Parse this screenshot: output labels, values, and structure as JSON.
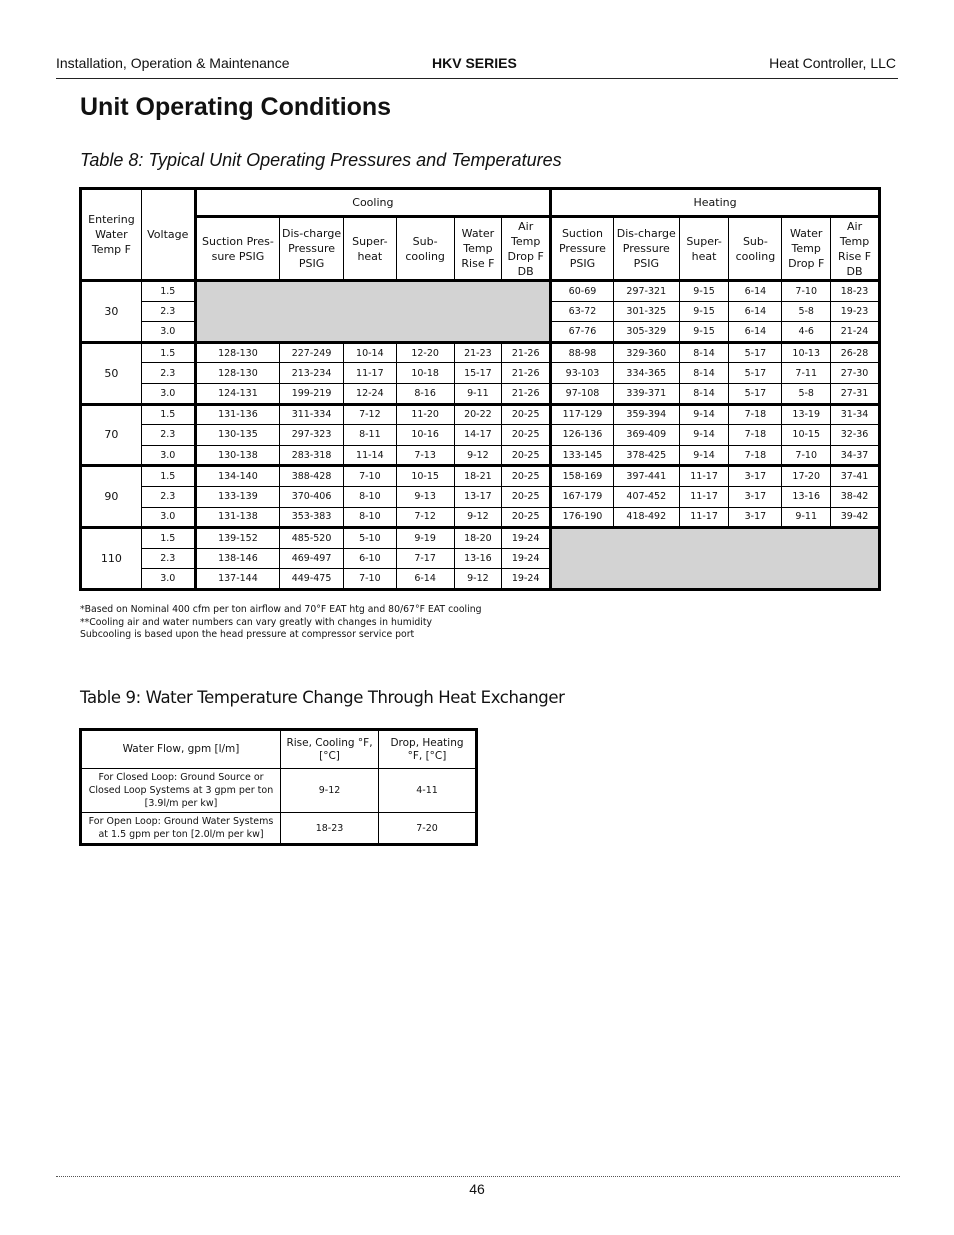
{
  "header": {
    "left": "Installation, Operation & Maintenance",
    "center": "HKV SERIES",
    "right": "Heat Controller, LLC"
  },
  "page_title": "Unit Operating Conditions",
  "table8": {
    "caption": "Table 8: Typical Unit Operating Pressures and Temperatures",
    "col_ewt": "Entering Water Temp F",
    "col_voltage": "Voltage",
    "group_cooling": "Cooling",
    "group_heating": "Heating",
    "cooling_cols": [
      "Suction Pres-sure PSIG",
      "Dis-charge Pressure PSIG",
      "Super-heat",
      "Sub-cooling",
      "Water Temp Rise F",
      "Air Temp Drop F DB"
    ],
    "heating_cols": [
      "Suction Pressure PSIG",
      "Dis-charge Pressure PSIG",
      "Super-heat",
      "Sub-cooling",
      "Water Temp Drop F",
      "Air Temp Rise F DB"
    ],
    "sections": [
      {
        "ewt": "30",
        "rows": [
          {
            "v": "1.5",
            "cooling": null,
            "heating": [
              "60-69",
              "297-321",
              "9-15",
              "6-14",
              "7-10",
              "18-23"
            ]
          },
          {
            "v": "2.3",
            "cooling": null,
            "heating": [
              "63-72",
              "301-325",
              "9-15",
              "6-14",
              "5-8",
              "19-23"
            ]
          },
          {
            "v": "3.0",
            "cooling": null,
            "heating": [
              "67-76",
              "305-329",
              "9-15",
              "6-14",
              "4-6",
              "21-24"
            ]
          }
        ]
      },
      {
        "ewt": "50",
        "rows": [
          {
            "v": "1.5",
            "cooling": [
              "128-130",
              "227-249",
              "10-14",
              "12-20",
              "21-23",
              "21-26"
            ],
            "heating": [
              "88-98",
              "329-360",
              "8-14",
              "5-17",
              "10-13",
              "26-28"
            ]
          },
          {
            "v": "2.3",
            "cooling": [
              "128-130",
              "213-234",
              "11-17",
              "10-18",
              "15-17",
              "21-26"
            ],
            "heating": [
              "93-103",
              "334-365",
              "8-14",
              "5-17",
              "7-11",
              "27-30"
            ]
          },
          {
            "v": "3.0",
            "cooling": [
              "124-131",
              "199-219",
              "12-24",
              "8-16",
              "9-11",
              "21-26"
            ],
            "heating": [
              "97-108",
              "339-371",
              "8-14",
              "5-17",
              "5-8",
              "27-31"
            ]
          }
        ]
      },
      {
        "ewt": "70",
        "rows": [
          {
            "v": "1.5",
            "cooling": [
              "131-136",
              "311-334",
              "7-12",
              "11-20",
              "20-22",
              "20-25"
            ],
            "heating": [
              "117-129",
              "359-394",
              "9-14",
              "7-18",
              "13-19",
              "31-34"
            ]
          },
          {
            "v": "2.3",
            "cooling": [
              "130-135",
              "297-323",
              "8-11",
              "10-16",
              "14-17",
              "20-25"
            ],
            "heating": [
              "126-136",
              "369-409",
              "9-14",
              "7-18",
              "10-15",
              "32-36"
            ]
          },
          {
            "v": "3.0",
            "cooling": [
              "130-138",
              "283-318",
              "11-14",
              "7-13",
              "9-12",
              "20-25"
            ],
            "heating": [
              "133-145",
              "378-425",
              "9-14",
              "7-18",
              "7-10",
              "34-37"
            ]
          }
        ]
      },
      {
        "ewt": "90",
        "rows": [
          {
            "v": "1.5",
            "cooling": [
              "134-140",
              "388-428",
              "7-10",
              "10-15",
              "18-21",
              "20-25"
            ],
            "heating": [
              "158-169",
              "397-441",
              "11-17",
              "3-17",
              "17-20",
              "37-41"
            ]
          },
          {
            "v": "2.3",
            "cooling": [
              "133-139",
              "370-406",
              "8-10",
              "9-13",
              "13-17",
              "20-25"
            ],
            "heating": [
              "167-179",
              "407-452",
              "11-17",
              "3-17",
              "13-16",
              "38-42"
            ]
          },
          {
            "v": "3.0",
            "cooling": [
              "131-138",
              "353-383",
              "8-10",
              "7-12",
              "9-12",
              "20-25"
            ],
            "heating": [
              "176-190",
              "418-492",
              "11-17",
              "3-17",
              "9-11",
              "39-42"
            ]
          }
        ]
      },
      {
        "ewt": "110",
        "rows": [
          {
            "v": "1.5",
            "cooling": [
              "139-152",
              "485-520",
              "5-10",
              "9-19",
              "18-20",
              "19-24"
            ],
            "heating": null
          },
          {
            "v": "2.3",
            "cooling": [
              "138-146",
              "469-497",
              "6-10",
              "7-17",
              "13-16",
              "19-24"
            ],
            "heating": null
          },
          {
            "v": "3.0",
            "cooling": [
              "137-144",
              "449-475",
              "7-10",
              "6-14",
              "9-12",
              "19-24"
            ],
            "heating": null
          }
        ]
      }
    ],
    "notes": [
      "*Based on Nominal 400 cfm per ton airflow and 70°F EAT htg and 80/67°F EAT cooling",
      "**Cooling air and water numbers can vary greatly with changes in humidity",
      "Subcooling is based upon the head pressure at compressor service port"
    ]
  },
  "table9": {
    "caption": "Table 9: Water Temperature Change Through Heat Exchanger",
    "headers": [
      "Water Flow, gpm [l/m]",
      "Rise, Cooling °F, [°C]",
      "Drop, Heating °F, [°C]"
    ],
    "rows": [
      {
        "flow": "For Closed Loop: Ground Source or Closed Loop Systems at 3 gpm per ton [3.9l/m per kw]",
        "rise": "9-12",
        "drop": "4-11"
      },
      {
        "flow": "For Open Loop: Ground Water Systems at 1.5 gpm per ton [2.0l/m per kw]",
        "rise": "18-23",
        "drop": "7-20"
      }
    ]
  },
  "footer": {
    "page_number": "46"
  }
}
